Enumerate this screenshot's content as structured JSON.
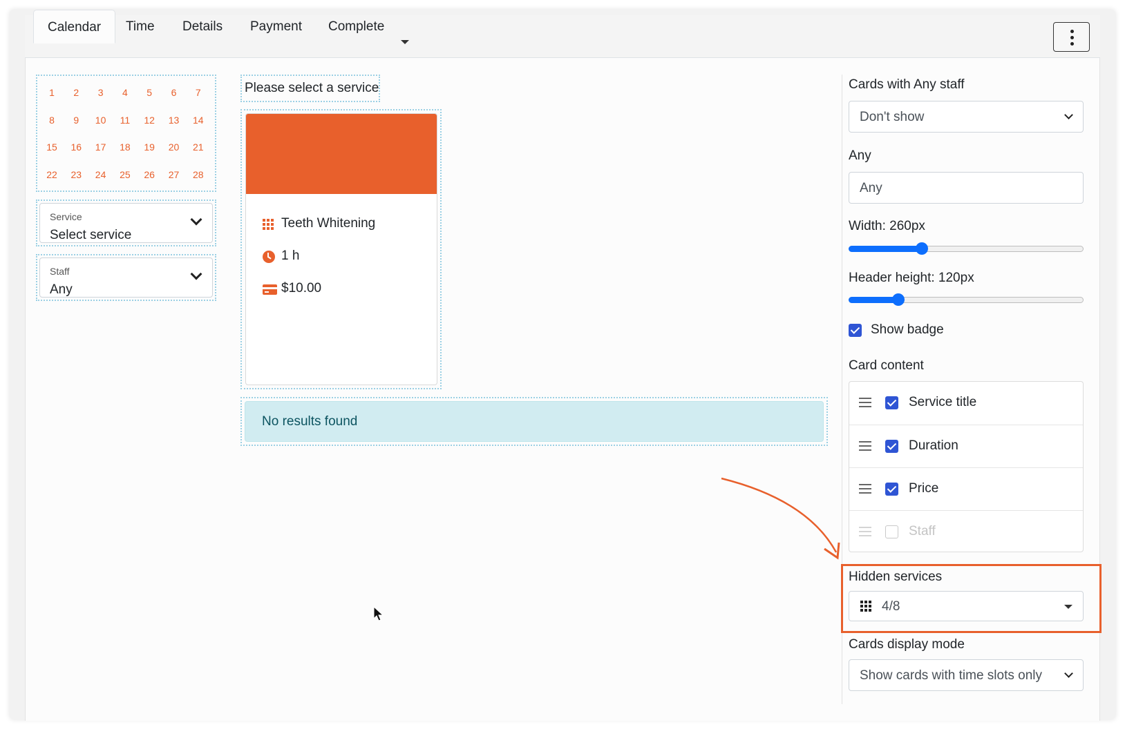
{
  "colors": {
    "accent": "#e8602c",
    "slider_blue": "#0d6efd",
    "checkbox_blue": "#2f55d4",
    "alert_bg": "#d1ecf1"
  },
  "tabs": [
    {
      "label": "Calendar",
      "active": true
    },
    {
      "label": "Time",
      "active": false
    },
    {
      "label": "Details",
      "active": false
    },
    {
      "label": "Payment",
      "active": false
    },
    {
      "label": "Complete",
      "active": false
    }
  ],
  "calendar": {
    "days": [
      "1",
      "2",
      "3",
      "4",
      "5",
      "6",
      "7",
      "8",
      "9",
      "10",
      "11",
      "12",
      "13",
      "14",
      "15",
      "16",
      "17",
      "18",
      "19",
      "20",
      "21",
      "22",
      "23",
      "24",
      "25",
      "26",
      "27",
      "28"
    ]
  },
  "service_select": {
    "label": "Service",
    "value": "Select service"
  },
  "staff_select": {
    "label": "Staff",
    "value": "Any"
  },
  "main": {
    "heading": "Please select a service",
    "card": {
      "title": "Teeth Whitening",
      "duration": "1 h",
      "price": "$10.00",
      "title_icon": "grid-icon",
      "duration_icon": "clock-icon",
      "price_icon": "credit-card-icon"
    },
    "no_results": "No results found"
  },
  "settings": {
    "cards_any_staff_label": "Cards with Any staff",
    "cards_any_staff_value": "Don't show",
    "any_label": "Any",
    "any_value": "Any",
    "width_label": "Width: 260px",
    "width_fraction": 0.31,
    "header_height_label": "Header height: 120px",
    "header_height_fraction": 0.21,
    "show_badge_label": "Show badge",
    "show_badge_checked": true,
    "card_content_label": "Card content",
    "card_content_items": [
      {
        "label": "Service title",
        "checked": true
      },
      {
        "label": "Duration",
        "checked": true
      },
      {
        "label": "Price",
        "checked": true
      },
      {
        "label": "Staff",
        "checked": false
      }
    ],
    "hidden_services_label": "Hidden services",
    "hidden_services_value": "4/8",
    "cards_display_mode_label": "Cards display mode",
    "cards_display_mode_value": "Show cards with time slots only"
  }
}
